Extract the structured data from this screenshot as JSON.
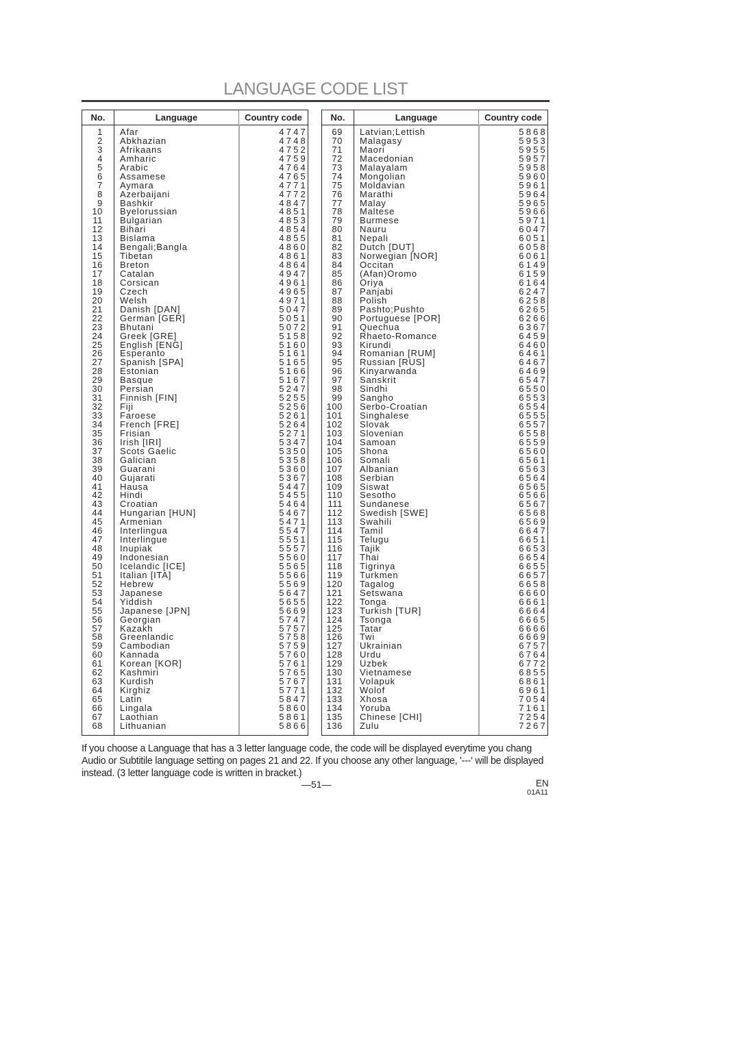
{
  "title": "LANGUAGE CODE LIST",
  "headers": {
    "no": "No.",
    "language": "Language",
    "code": "Country code"
  },
  "left_rows": [
    [
      "1",
      "Afar",
      "4747"
    ],
    [
      "2",
      "Abkhazian",
      "4748"
    ],
    [
      "3",
      "Afrikaans",
      "4752"
    ],
    [
      "4",
      "Amharic",
      "4759"
    ],
    [
      "5",
      "Arabic",
      "4764"
    ],
    [
      "6",
      "Assamese",
      "4765"
    ],
    [
      "7",
      "Aymara",
      "4771"
    ],
    [
      "8",
      "Azerbaijani",
      "4772"
    ],
    [
      "9",
      "Bashkir",
      "4847"
    ],
    [
      "10",
      "Byelorussian",
      "4851"
    ],
    [
      "11",
      "Bulgarian",
      "4853"
    ],
    [
      "12",
      "Bihari",
      "4854"
    ],
    [
      "13",
      "Bislama",
      "4855"
    ],
    [
      "14",
      "Bengali;Bangla",
      "4860"
    ],
    [
      "15",
      "Tibetan",
      "4861"
    ],
    [
      "16",
      "Breton",
      "4864"
    ],
    [
      "17",
      "Catalan",
      "4947"
    ],
    [
      "18",
      "Corsican",
      "4961"
    ],
    [
      "19",
      "Czech",
      "4965"
    ],
    [
      "20",
      "Welsh",
      "4971"
    ],
    [
      "21",
      "Danish [DAN]",
      "5047"
    ],
    [
      "22",
      "German [GER]",
      "5051"
    ],
    [
      "23",
      "Bhutani",
      "5072"
    ],
    [
      "24",
      "Greek [GRE]",
      "5158"
    ],
    [
      "25",
      "English [ENG]",
      "5160"
    ],
    [
      "26",
      "Esperanto",
      "5161"
    ],
    [
      "27",
      "Spanish [SPA]",
      "5165"
    ],
    [
      "28",
      "Estonian",
      "5166"
    ],
    [
      "29",
      "Basque",
      "5167"
    ],
    [
      "30",
      "Persian",
      "5247"
    ],
    [
      "31",
      "Finnish [FIN]",
      "5255"
    ],
    [
      "32",
      "Fiji",
      "5256"
    ],
    [
      "33",
      "Faroese",
      "5261"
    ],
    [
      "34",
      "French [FRE]",
      "5264"
    ],
    [
      "35",
      "Frisian",
      "5271"
    ],
    [
      "36",
      "Irish [IRI]",
      "5347"
    ],
    [
      "37",
      "Scots Gaelic",
      "5350"
    ],
    [
      "38",
      "Galician",
      "5358"
    ],
    [
      "39",
      "Guarani",
      "5360"
    ],
    [
      "40",
      "Gujarati",
      "5367"
    ],
    [
      "41",
      "Hausa",
      "5447"
    ],
    [
      "42",
      "Hindi",
      "5455"
    ],
    [
      "43",
      "Croatian",
      "5464"
    ],
    [
      "44",
      "Hungarian [HUN]",
      "5467"
    ],
    [
      "45",
      "Armenian",
      "5471"
    ],
    [
      "46",
      "Interlingua",
      "5547"
    ],
    [
      "47",
      "Interlingue",
      "5551"
    ],
    [
      "48",
      "Inupiak",
      "5557"
    ],
    [
      "49",
      "Indonesian",
      "5560"
    ],
    [
      "50",
      "Icelandic [ICE]",
      "5565"
    ],
    [
      "51",
      "Italian [ITA]",
      "5566"
    ],
    [
      "52",
      "Hebrew",
      "5569"
    ],
    [
      "53",
      "Japanese",
      "5647"
    ],
    [
      "54",
      "Yiddish",
      "5655"
    ],
    [
      "55",
      "Japanese [JPN]",
      "5669"
    ],
    [
      "56",
      "Georgian",
      "5747"
    ],
    [
      "57",
      "Kazakh",
      "5757"
    ],
    [
      "58",
      "Greenlandic",
      "5758"
    ],
    [
      "59",
      "Cambodian",
      "5759"
    ],
    [
      "60",
      "Kannada",
      "5760"
    ],
    [
      "61",
      "Korean [KOR]",
      "5761"
    ],
    [
      "62",
      "Kashmiri",
      "5765"
    ],
    [
      "63",
      "Kurdish",
      "5767"
    ],
    [
      "64",
      "Kirghiz",
      "5771"
    ],
    [
      "65",
      "Latin",
      "5847"
    ],
    [
      "66",
      "Lingala",
      "5860"
    ],
    [
      "67",
      "Laothian",
      "5861"
    ],
    [
      "68",
      "Lithuanian",
      "5866"
    ]
  ],
  "right_rows": [
    [
      "69",
      "Latvian;Lettish",
      "5868"
    ],
    [
      "70",
      "Malagasy",
      "5953"
    ],
    [
      "71",
      "Maori",
      "5955"
    ],
    [
      "72",
      "Macedonian",
      "5957"
    ],
    [
      "73",
      "Malayalam",
      "5958"
    ],
    [
      "74",
      "Mongolian",
      "5960"
    ],
    [
      "75",
      "Moldavian",
      "5961"
    ],
    [
      "76",
      "Marathi",
      "5964"
    ],
    [
      "77",
      "Malay",
      "5965"
    ],
    [
      "78",
      "Maltese",
      "5966"
    ],
    [
      "79",
      "Burmese",
      "5971"
    ],
    [
      "80",
      "Nauru",
      "6047"
    ],
    [
      "81",
      "Nepali",
      "6051"
    ],
    [
      "82",
      "Dutch [DUT]",
      "6058"
    ],
    [
      "83",
      "Norwegian [NOR]",
      "6061"
    ],
    [
      "84",
      "Occitan",
      "6149"
    ],
    [
      "85",
      "(Afan)Oromo",
      "6159"
    ],
    [
      "86",
      "Oriya",
      "6164"
    ],
    [
      "87",
      "Panjabi",
      "6247"
    ],
    [
      "88",
      "Polish",
      "6258"
    ],
    [
      "89",
      "Pashto;Pushto",
      "6265"
    ],
    [
      "90",
      "Portuguese [POR]",
      "6266"
    ],
    [
      "91",
      "Quechua",
      "6367"
    ],
    [
      "92",
      "Rhaeto-Romance",
      "6459"
    ],
    [
      "93",
      "Kirundi",
      "6460"
    ],
    [
      "94",
      "Romanian [RUM]",
      "6461"
    ],
    [
      "95",
      "Russian [RUS]",
      "6467"
    ],
    [
      "96",
      "Kinyarwanda",
      "6469"
    ],
    [
      "97",
      "Sanskrit",
      "6547"
    ],
    [
      "98",
      "Sindhi",
      "6550"
    ],
    [
      "99",
      "Sangho",
      "6553"
    ],
    [
      "100",
      "Serbo-Croatian",
      "6554"
    ],
    [
      "101",
      "Singhalese",
      "6555"
    ],
    [
      "102",
      "Slovak",
      "6557"
    ],
    [
      "103",
      "Slovenian",
      "6558"
    ],
    [
      "104",
      "Samoan",
      "6559"
    ],
    [
      "105",
      "Shona",
      "6560"
    ],
    [
      "106",
      "Somali",
      "6561"
    ],
    [
      "107",
      "Albanian",
      "6563"
    ],
    [
      "108",
      "Serbian",
      "6564"
    ],
    [
      "109",
      "Siswat",
      "6565"
    ],
    [
      "110",
      "Sesotho",
      "6566"
    ],
    [
      "111",
      "Sundanese",
      "6567"
    ],
    [
      "112",
      "Swedish [SWE]",
      "6568"
    ],
    [
      "113",
      "Swahili",
      "6569"
    ],
    [
      "114",
      "Tamil",
      "6647"
    ],
    [
      "115",
      "Telugu",
      "6651"
    ],
    [
      "116",
      "Tajik",
      "6653"
    ],
    [
      "117",
      "Thai",
      "6654"
    ],
    [
      "118",
      "Tigrinya",
      "6655"
    ],
    [
      "119",
      "Turkmen",
      "6657"
    ],
    [
      "120",
      "Tagalog",
      "6658"
    ],
    [
      "121",
      "Setswana",
      "6660"
    ],
    [
      "122",
      "Tonga",
      "6661"
    ],
    [
      "123",
      "Turkish [TUR]",
      "6664"
    ],
    [
      "124",
      "Tsonga",
      "6665"
    ],
    [
      "125",
      "Tatar",
      "6666"
    ],
    [
      "126",
      "Twi",
      "6669"
    ],
    [
      "127",
      "Ukrainian",
      "6757"
    ],
    [
      "128",
      "Urdu",
      "6764"
    ],
    [
      "129",
      "Uzbek",
      "6772"
    ],
    [
      "130",
      "Vietnamese",
      "6855"
    ],
    [
      "131",
      "Volapuk",
      "6861"
    ],
    [
      "132",
      "Wolof",
      "6961"
    ],
    [
      "133",
      "Xhosa",
      "7054"
    ],
    [
      "134",
      "Yoruba",
      "7161"
    ],
    [
      "135",
      "Chinese [CHI]",
      "7254"
    ],
    [
      "136",
      "Zulu",
      "7267"
    ]
  ],
  "note": {
    "line1": "If you choose a Language that has a 3 letter language code, the code will be displayed everytime you chang",
    "line2": "Audio or Subtitile language setting on pages 21 and 22. If you choose any other language, '---' will be displayed",
    "line3": "instead. (3 letter language code is written in bracket.)"
  },
  "footer": {
    "page": "—51—",
    "lang": "EN",
    "doc_id": "01A11"
  }
}
